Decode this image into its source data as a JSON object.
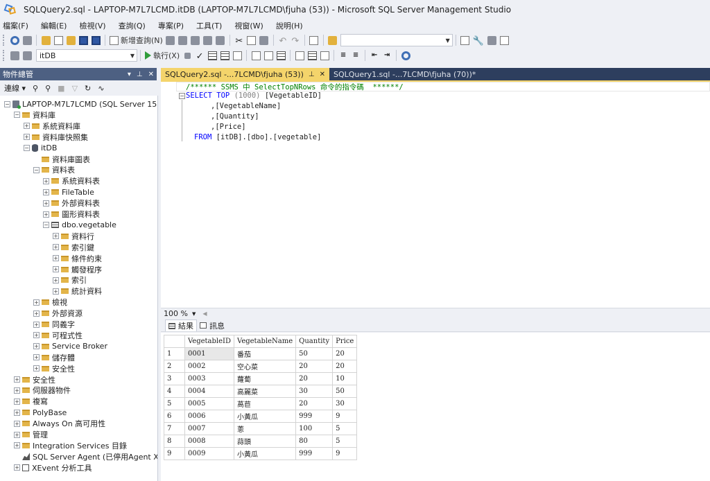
{
  "window": {
    "title": "SQLQuery2.sql - LAPTOP-M7L7LCMD.itDB (LAPTOP-M7L7LCMD\\fjuha (53)) - Microsoft SQL Server Management Studio"
  },
  "menu": [
    "檔案(F)",
    "編輯(E)",
    "檢視(V)",
    "查詢(Q)",
    "專案(P)",
    "工具(T)",
    "視窗(W)",
    "說明(H)"
  ],
  "toolbar": {
    "new_query": "新增查詢(N)",
    "database": "itDB",
    "execute": "執行(X)",
    "search_box": ""
  },
  "object_explorer": {
    "title": "物件總管",
    "connect": "連線",
    "tree": [
      {
        "label": "LAPTOP-M7L7LCMD (SQL Server 15.0.",
        "level": 0,
        "exp": "−",
        "icon": "server"
      },
      {
        "label": "資料庫",
        "level": 1,
        "exp": "−",
        "icon": "folder"
      },
      {
        "label": "系統資料庫",
        "level": 2,
        "exp": "+",
        "icon": "folder"
      },
      {
        "label": "資料庫快照集",
        "level": 2,
        "exp": "+",
        "icon": "folder"
      },
      {
        "label": "itDB",
        "level": 2,
        "exp": "−",
        "icon": "db"
      },
      {
        "label": "資料庫圖表",
        "level": 3,
        "exp": "",
        "icon": "folder"
      },
      {
        "label": "資料表",
        "level": 3,
        "exp": "−",
        "icon": "folder"
      },
      {
        "label": "系統資料表",
        "level": 4,
        "exp": "+",
        "icon": "folder"
      },
      {
        "label": "FileTable",
        "level": 4,
        "exp": "+",
        "icon": "folder"
      },
      {
        "label": "外部資料表",
        "level": 4,
        "exp": "+",
        "icon": "folder"
      },
      {
        "label": "圖形資料表",
        "level": 4,
        "exp": "+",
        "icon": "folder"
      },
      {
        "label": "dbo.vegetable",
        "level": 4,
        "exp": "−",
        "icon": "table"
      },
      {
        "label": "資料行",
        "level": 5,
        "exp": "+",
        "icon": "folder"
      },
      {
        "label": "索引鍵",
        "level": 5,
        "exp": "+",
        "icon": "folder"
      },
      {
        "label": "條件約束",
        "level": 5,
        "exp": "+",
        "icon": "folder"
      },
      {
        "label": "觸發程序",
        "level": 5,
        "exp": "+",
        "icon": "folder"
      },
      {
        "label": "索引",
        "level": 5,
        "exp": "+",
        "icon": "folder"
      },
      {
        "label": "統計資料",
        "level": 5,
        "exp": "+",
        "icon": "folder"
      },
      {
        "label": "檢視",
        "level": 3,
        "exp": "+",
        "icon": "folder"
      },
      {
        "label": "外部資源",
        "level": 3,
        "exp": "+",
        "icon": "folder"
      },
      {
        "label": "同義字",
        "level": 3,
        "exp": "+",
        "icon": "folder"
      },
      {
        "label": "可程式性",
        "level": 3,
        "exp": "+",
        "icon": "folder"
      },
      {
        "label": "Service Broker",
        "level": 3,
        "exp": "+",
        "icon": "folder"
      },
      {
        "label": "儲存體",
        "level": 3,
        "exp": "+",
        "icon": "folder"
      },
      {
        "label": "安全性",
        "level": 3,
        "exp": "+",
        "icon": "folder"
      },
      {
        "label": "安全性",
        "level": 1,
        "exp": "+",
        "icon": "folder"
      },
      {
        "label": "伺服器物件",
        "level": 1,
        "exp": "+",
        "icon": "folder"
      },
      {
        "label": "複寫",
        "level": 1,
        "exp": "+",
        "icon": "folder"
      },
      {
        "label": "PolyBase",
        "level": 1,
        "exp": "+",
        "icon": "folder"
      },
      {
        "label": "Always On 高可用性",
        "level": 1,
        "exp": "+",
        "icon": "folder"
      },
      {
        "label": "管理",
        "level": 1,
        "exp": "+",
        "icon": "folder"
      },
      {
        "label": "Integration Services 目錄",
        "level": 1,
        "exp": "+",
        "icon": "folder"
      },
      {
        "label": "SQL Server Agent (已停用Agent XPs",
        "level": 1,
        "exp": "",
        "icon": "agent"
      },
      {
        "label": "XEvent 分析工具",
        "level": 1,
        "exp": "+",
        "icon": "xevent"
      }
    ]
  },
  "tabs": [
    {
      "label": "SQLQuery2.sql -...7LCMD\\fjuha (53))",
      "active": true
    },
    {
      "label": "SQLQuery1.sql -...7LCMD\\fjuha (70))*",
      "active": false
    }
  ],
  "editor": {
    "comment": "/****** SSMS 中 SelectTopNRows 命令的指令碼  ******/",
    "select_kw": "SELECT",
    "top_kw": "TOP",
    "top_n": "(1000)",
    "col1": "[VegetableID]",
    "col2": ",[VegetableName]",
    "col3": ",[Quantity]",
    "col4": ",[Price]",
    "from_kw": "FROM",
    "from_target": "[itDB].[dbo].[vegetable]"
  },
  "zoom": "100 %",
  "result_tabs": {
    "results": "結果",
    "messages": "訊息"
  },
  "results": {
    "columns": [
      "VegetableID",
      "VegetableName",
      "Quantity",
      "Price"
    ],
    "rows": [
      [
        "1",
        "0001",
        "番茄",
        "50",
        "20"
      ],
      [
        "2",
        "0002",
        "空心菜",
        "20",
        "20"
      ],
      [
        "3",
        "0003",
        "蘿蔔",
        "20",
        "10"
      ],
      [
        "4",
        "0004",
        "高麗菜",
        "30",
        "50"
      ],
      [
        "5",
        "0005",
        "萵苣",
        "20",
        "30"
      ],
      [
        "6",
        "0006",
        "小黃瓜",
        "999",
        "9"
      ],
      [
        "7",
        "0007",
        "蔥",
        "100",
        "5"
      ],
      [
        "8",
        "0008",
        "蒜頭",
        "80",
        "5"
      ],
      [
        "9",
        "0009",
        "小黃瓜",
        "999",
        "9"
      ]
    ]
  }
}
